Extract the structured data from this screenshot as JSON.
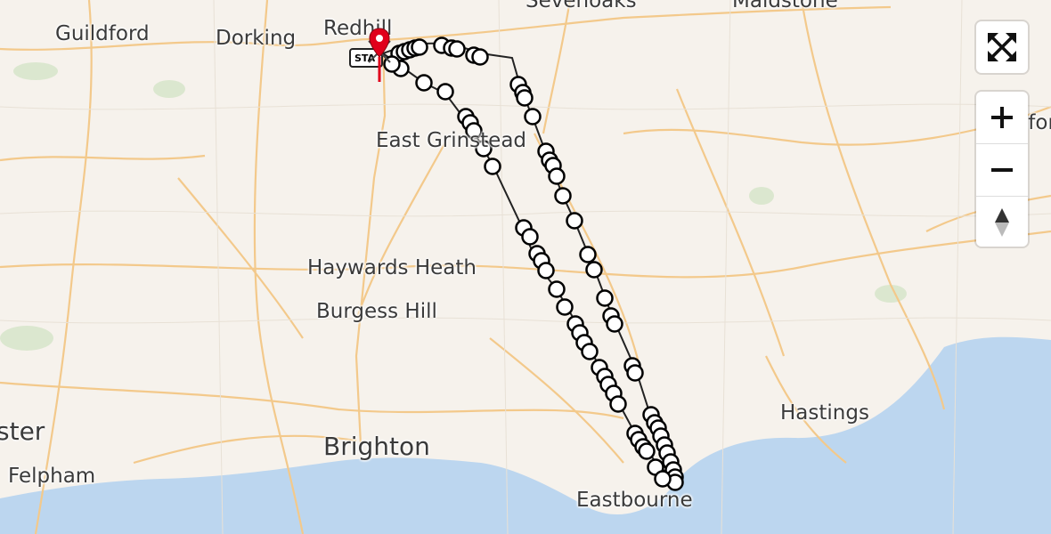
{
  "map": {
    "land_color": "#f6f2ec",
    "sea_color": "#bcd6ef",
    "road_color": "#f3c98b",
    "route_color": "#222222",
    "marker_color": "#e0001b",
    "places": [
      {
        "name": "Guildford",
        "size": "medium"
      },
      {
        "name": "Dorking",
        "size": "medium"
      },
      {
        "name": "Redhill",
        "size": "medium"
      },
      {
        "name": "Sevenoaks",
        "size": "medium"
      },
      {
        "name": "Maidstone",
        "size": "medium"
      },
      {
        "name": "East Grinstead",
        "size": "medium"
      },
      {
        "name": "Haywards Heath",
        "size": "medium"
      },
      {
        "name": "Burgess Hill",
        "size": "medium"
      },
      {
        "name": "Brighton",
        "size": "large"
      },
      {
        "name": "Eastbourne",
        "size": "medium"
      },
      {
        "name": "Hastings",
        "size": "medium"
      },
      {
        "name": "Felpham",
        "size": "medium"
      },
      {
        "name": "ster",
        "size": "large"
      },
      {
        "name": "Ashford",
        "size": "medium"
      }
    ],
    "station_badge": "STA",
    "marker_icon": "ambulance-pin-icon"
  },
  "controls": {
    "fullscreen_icon": "fullscreen-icon",
    "zoom_in_icon": "plus-icon",
    "zoom_out_icon": "minus-icon",
    "reset_icon": "compass-icon"
  }
}
